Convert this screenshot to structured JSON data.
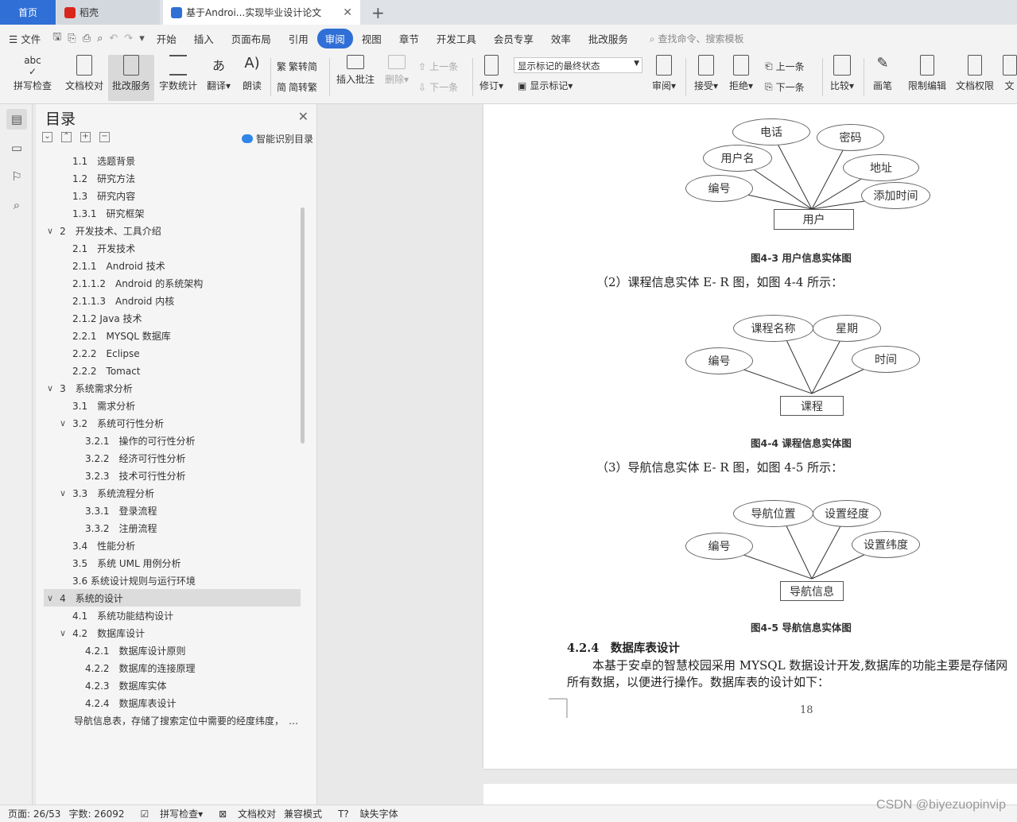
{
  "tabs": {
    "home": "首页",
    "daoke": "稻壳",
    "doc": "基于Androi...实现毕业设计论文"
  },
  "menu": {
    "file": "文件",
    "items": [
      "开始",
      "插入",
      "页面布局",
      "引用",
      "审阅",
      "视图",
      "章节",
      "开发工具",
      "会员专享",
      "效率",
      "批改服务"
    ],
    "active": "审阅",
    "search": "查找命令、搜索模板"
  },
  "ribbon": {
    "spell": "拼写检查",
    "proof": "文档校对",
    "correct": "批改服务",
    "count": "字数统计",
    "translate": "翻译",
    "read": "朗读",
    "t2s": "繁转简",
    "s2t": "简转繁",
    "insert_comment": "插入批注",
    "delete": "删除",
    "prev": "上一条",
    "next": "下一条",
    "track": "修订",
    "markup_state": "显示标记的最终状态",
    "show_markup": "显示标记",
    "review": "审阅",
    "accept": "接受",
    "reject": "拒绝",
    "prev2": "上一条",
    "next2": "下一条",
    "compare": "比较",
    "pen": "画笔",
    "restrict": "限制编辑",
    "perm": "文档权限",
    "more": "文"
  },
  "toc": {
    "title": "目录",
    "smart": "智能识别目录",
    "items": [
      {
        "t": "1.1　选题背景",
        "lv": 3
      },
      {
        "t": "1.2　研究方法",
        "lv": 3
      },
      {
        "t": "1.3　研究内容",
        "lv": 3
      },
      {
        "t": "1.3.1　研究框架",
        "lv": 3
      },
      {
        "t": "2　开发技术、工具介绍",
        "lv": 1,
        "c": "v"
      },
      {
        "t": "2.1　开发技术",
        "lv": 3
      },
      {
        "t": "2.1.1　Android 技术",
        "lv": 3
      },
      {
        "t": "2.1.1.2　Android 的系统架构",
        "lv": 3
      },
      {
        "t": "2.1.1.3　Android 内核",
        "lv": 3
      },
      {
        "t": "2.1.2 Java 技术",
        "lv": 3
      },
      {
        "t": "2.2.1　MYSQL 数据库",
        "lv": 3
      },
      {
        "t": "2.2.2　Eclipse",
        "lv": 3
      },
      {
        "t": "2.2.2　Tomact",
        "lv": 3
      },
      {
        "t": "3　系统需求分析",
        "lv": 1,
        "c": "v"
      },
      {
        "t": "3.1　需求分析",
        "lv": 3
      },
      {
        "t": "3.2　系统可行性分析",
        "lv": 2,
        "c": "v"
      },
      {
        "t": "3.2.1　操作的可行性分析",
        "lv": 4
      },
      {
        "t": "3.2.2　经济可行性分析",
        "lv": 4
      },
      {
        "t": "3.2.3　技术可行性分析",
        "lv": 4
      },
      {
        "t": "3.3　系统流程分析",
        "lv": 2,
        "c": "v"
      },
      {
        "t": "3.3.1　登录流程",
        "lv": 4
      },
      {
        "t": "3.3.2　注册流程",
        "lv": 4
      },
      {
        "t": "3.4　性能分析",
        "lv": 3
      },
      {
        "t": "3.5　系统 UML 用例分析",
        "lv": 3
      },
      {
        "t": "3.6 系统设计规则与运行环境",
        "lv": 3
      },
      {
        "t": "4　系统的设计",
        "lv": 1,
        "c": "v",
        "hl": true
      },
      {
        "t": "4.1　系统功能结构设计",
        "lv": 3
      },
      {
        "t": "4.2　数据库设计",
        "lv": 2,
        "c": "v"
      },
      {
        "t": "4.2.1　数据库设计原则",
        "lv": 4
      },
      {
        "t": "4.2.2　数据库的连接原理",
        "lv": 4
      },
      {
        "t": "4.2.3　数据库实体",
        "lv": 4
      },
      {
        "t": "4.2.4　数据库表设计",
        "lv": 4
      },
      {
        "t": "导航信息表，存储了搜索定位中需要的经度纬度，　…",
        "lv": 5
      }
    ]
  },
  "doc": {
    "er1": {
      "entity": "用户",
      "attrs": [
        "电话",
        "密码",
        "用户名",
        "地址",
        "编号",
        "添加时间"
      ],
      "caption": "图4-3  用户信息实体图"
    },
    "p2": "（2）课程信息实体 E- R 图，如图 4-4 所示：",
    "er2": {
      "entity": "课程",
      "attrs": [
        "课程名称",
        "星期",
        "编号",
        "时间"
      ],
      "caption": "图4-4  课程信息实体图"
    },
    "p3": "（3）导航信息实体 E- R 图，如图 4-5 所示：",
    "er3": {
      "entity": "导航信息",
      "attrs": [
        "导航位置",
        "设置经度",
        "编号",
        "设置纬度"
      ],
      "caption": "图4-5  导航信息实体图"
    },
    "heading": "4.2.4　数据库表设计",
    "body1": "本基于安卓的智慧校园采用 MYSQL 数据设计开发,数据库的功能主要是存储网",
    "body2": "所有数据，以便进行操作。数据库表的设计如下：",
    "pagenum": "18"
  },
  "status": {
    "page": "页面: 26/53",
    "words": "字数: 26092",
    "spell": "拼写检查",
    "proof": "文档校对",
    "compat": "兼容模式",
    "font": "缺失字体"
  },
  "watermark": "CSDN @biyezuopinvip"
}
